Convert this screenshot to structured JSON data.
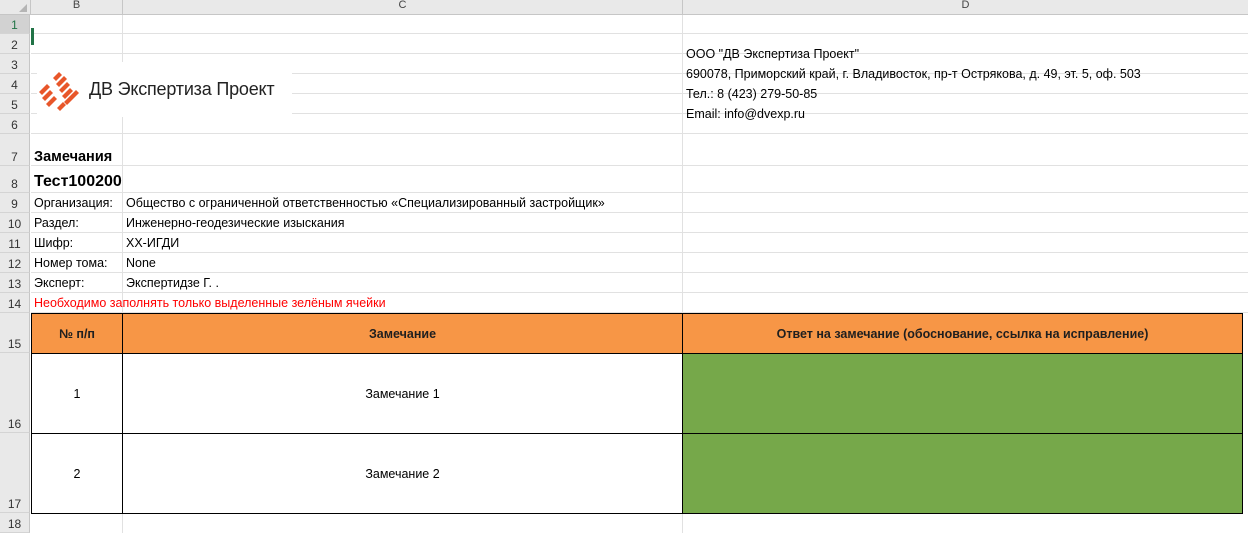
{
  "columns": [
    "B",
    "C",
    "D"
  ],
  "rows": [
    "1",
    "2",
    "3",
    "4",
    "5",
    "6",
    "7",
    "8",
    "9",
    "10",
    "11",
    "12",
    "13",
    "14",
    "15",
    "16",
    "17",
    "18"
  ],
  "logo": {
    "icon": "dv-logo-icon",
    "text": "ДВ Экспертиза Проект",
    "color": "#e8562a"
  },
  "company": {
    "name": "ООО \"ДВ Экспертиза Проект\"",
    "address": "690078, Приморский край, г. Владивосток, пр-т Острякова, д. 49, эт. 5, оф. 503",
    "phone": "Тел.: 8 (423) 279-50-85",
    "email": "Email: info@dvexp.ru"
  },
  "title": "Замечания",
  "doc_id": "Тест100200",
  "fields": [
    {
      "label": "Организация:",
      "value": "Общество с ограниченной ответственностью «Специализированный застройщик»"
    },
    {
      "label": "Раздел:",
      "value": "Инженерно-геодезические изыскания"
    },
    {
      "label": "Шифр:",
      "value": "ХХ-ИГДИ"
    },
    {
      "label": "Номер тома:",
      "value": "None"
    },
    {
      "label": "Эксперт:",
      "value": "Экспертидзе Г. ."
    }
  ],
  "note": "Необходимо заполнять только выделенные зелёным ячейки",
  "table": {
    "headers": [
      "№ п/п",
      "Замечание",
      "Ответ на замечание (обоснование, ссылка на исправление)"
    ],
    "rows": [
      {
        "num": "1",
        "remark": "Замечание 1",
        "answer": ""
      },
      {
        "num": "2",
        "remark": "Замечание 2",
        "answer": ""
      }
    ]
  },
  "colors": {
    "header": "#f79646",
    "answer": "#76a84a",
    "note": "#ff0000",
    "excel_green": "#217346"
  }
}
